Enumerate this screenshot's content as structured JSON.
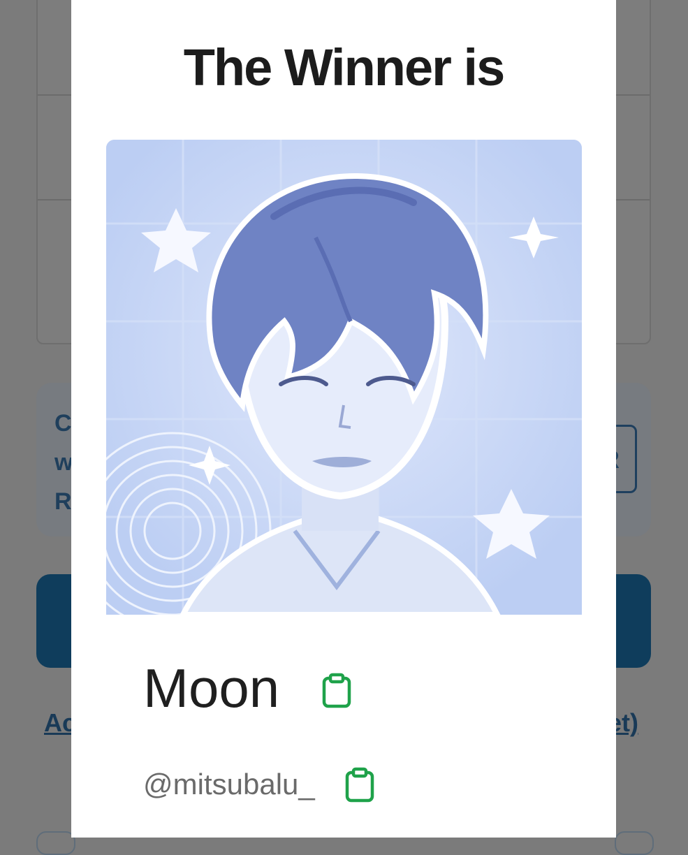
{
  "background": {
    "info_text_lines": [
      "C",
      "w",
      "R"
    ],
    "info_button_label": "R",
    "link_left_text": "Ac",
    "link_right_text": "et)"
  },
  "modal": {
    "title": "The Winner is",
    "winner": {
      "name": "Moon",
      "handle": "@mitsubalu_"
    }
  },
  "colors": {
    "copy_icon": "#1fa24a",
    "image_background": "#c2d3f4",
    "primary_button": "#0f3d5c"
  },
  "icons": {
    "copy_name": "clipboard-icon",
    "copy_handle": "clipboard-icon"
  }
}
